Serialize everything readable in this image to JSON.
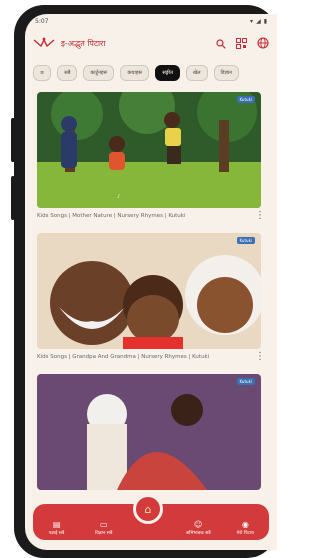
{
  "status": {
    "time": "5:07"
  },
  "app": {
    "title": "इ-अद्भुत पिटारा"
  },
  "chips": [
    {
      "label": "≡"
    },
    {
      "label": "सबै"
    },
    {
      "label": "कार्टुनहरू"
    },
    {
      "label": "कथाहरू"
    },
    {
      "label": "सङ्गीत"
    },
    {
      "label": "खेल"
    },
    {
      "label": "विज्ञान"
    }
  ],
  "videos": [
    {
      "title": "Kids Songs | Mother Nature | Nursery Rhymes | Kutuki",
      "badge": "Kutuki"
    },
    {
      "title": "Kids Songs | Grandpa And Grandma | Nursery Rhymes | Kutuki",
      "badge": "Kutuki"
    },
    {
      "badge": "Kutuki"
    }
  ],
  "nav": {
    "items": [
      {
        "label": "पढाई सबै",
        "icon": "book-icon"
      },
      {
        "label": "विज्ञान सबै",
        "icon": "chat-icon"
      },
      {
        "label": "अभिभावक सबै",
        "icon": "family-icon"
      },
      {
        "label": "मेरो पिटारा",
        "icon": "box-icon"
      }
    ]
  },
  "colors": {
    "accent": "#d23a3c",
    "background": "#f7f1ea"
  }
}
